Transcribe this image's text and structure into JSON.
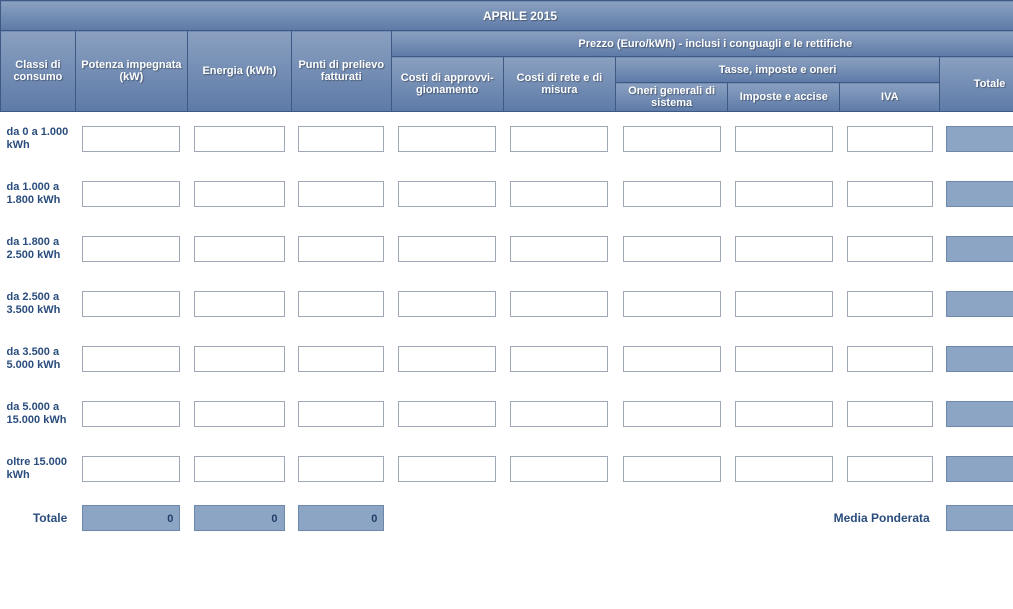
{
  "title": "APRILE 2015",
  "headers": {
    "classi": "Classi di consumo",
    "potenza": "Potenza impegnata (kW)",
    "energia": "Energia (kWh)",
    "punti": "Punti di prelievo fatturati",
    "prezzo_group": "Prezzo (Euro/kWh) - inclusi i conguagli e le rettifiche",
    "approvv": "Costi di approvvi-gionamento",
    "rete": "Costi di rete e di misura",
    "tasse_group": "Tasse, imposte e oneri",
    "oneri": "Oneri generali di sistema",
    "imposte": "Imposte e accise",
    "iva": "IVA",
    "totale": "Totale"
  },
  "rows": [
    {
      "label": "da 0 a 1.000 kWh"
    },
    {
      "label": "da 1.000 a 1.800 kWh"
    },
    {
      "label": "da 1.800 a 2.500 kWh"
    },
    {
      "label": "da 2.500 a 3.500 kWh"
    },
    {
      "label": "da 3.500 a 5.000 kWh"
    },
    {
      "label": "da 5.000 a 15.000 kWh"
    },
    {
      "label": "oltre 15.000 kWh"
    }
  ],
  "footer": {
    "totale_label": "Totale",
    "potenza_total": "0",
    "energia_total": "0",
    "punti_total": "0",
    "media_label": "Media Ponderata"
  }
}
